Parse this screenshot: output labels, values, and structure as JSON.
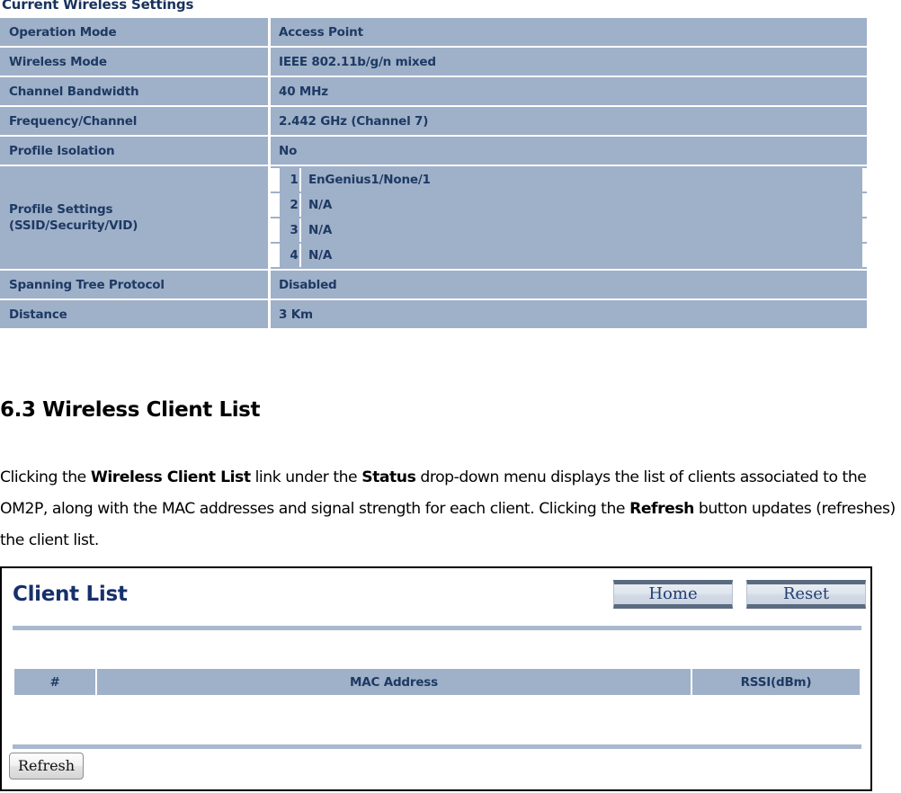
{
  "settings": {
    "heading": "Current Wireless Settings",
    "rows": [
      {
        "label": "Operation Mode",
        "value": "Access Point"
      },
      {
        "label": "Wireless Mode",
        "value": "IEEE 802.11b/g/n mixed"
      },
      {
        "label": "Channel Bandwidth",
        "value": "40 MHz"
      },
      {
        "label": "Frequency/Channel",
        "value": "2.442 GHz (Channel 7)"
      },
      {
        "label": "Profile Isolation",
        "value": "No"
      }
    ],
    "profile_label_line1": "Profile Settings",
    "profile_label_line2": "(SSID/Security/VID)",
    "profiles": [
      {
        "num": "1",
        "value": "EnGenius1/None/1"
      },
      {
        "num": "2",
        "value": "N/A"
      },
      {
        "num": "3",
        "value": "N/A"
      },
      {
        "num": "4",
        "value": "N/A"
      }
    ],
    "tail_rows": [
      {
        "label": "Spanning Tree Protocol",
        "value": "Disabled"
      },
      {
        "label": "Distance",
        "value": "3 Km"
      }
    ]
  },
  "section": {
    "heading": "6.3 Wireless Client List",
    "paragraph": {
      "p1": "Clicking the ",
      "b1": "Wireless Client List",
      "p2": " link under the ",
      "b2": "Status",
      "p3": " drop-down menu displays the list of clients associated to the OM2P, along with the MAC addresses and signal strength for each client. Clicking the ",
      "b3": "Refresh",
      "p4": " button updates (refreshes) the client list."
    }
  },
  "client_list": {
    "title": "Client List",
    "home_label": "Home",
    "reset_label": "Reset",
    "columns": [
      "#",
      "MAC Address",
      "RSSI(dBm)"
    ],
    "rows": [],
    "refresh_label": "Refresh"
  },
  "colors": {
    "table_cell_bg": "#9fb0c9",
    "table_text": "#1d3a63",
    "panel_title": "#16306b",
    "rule": "#a9b8cf",
    "button_text": "#1f3f73"
  }
}
